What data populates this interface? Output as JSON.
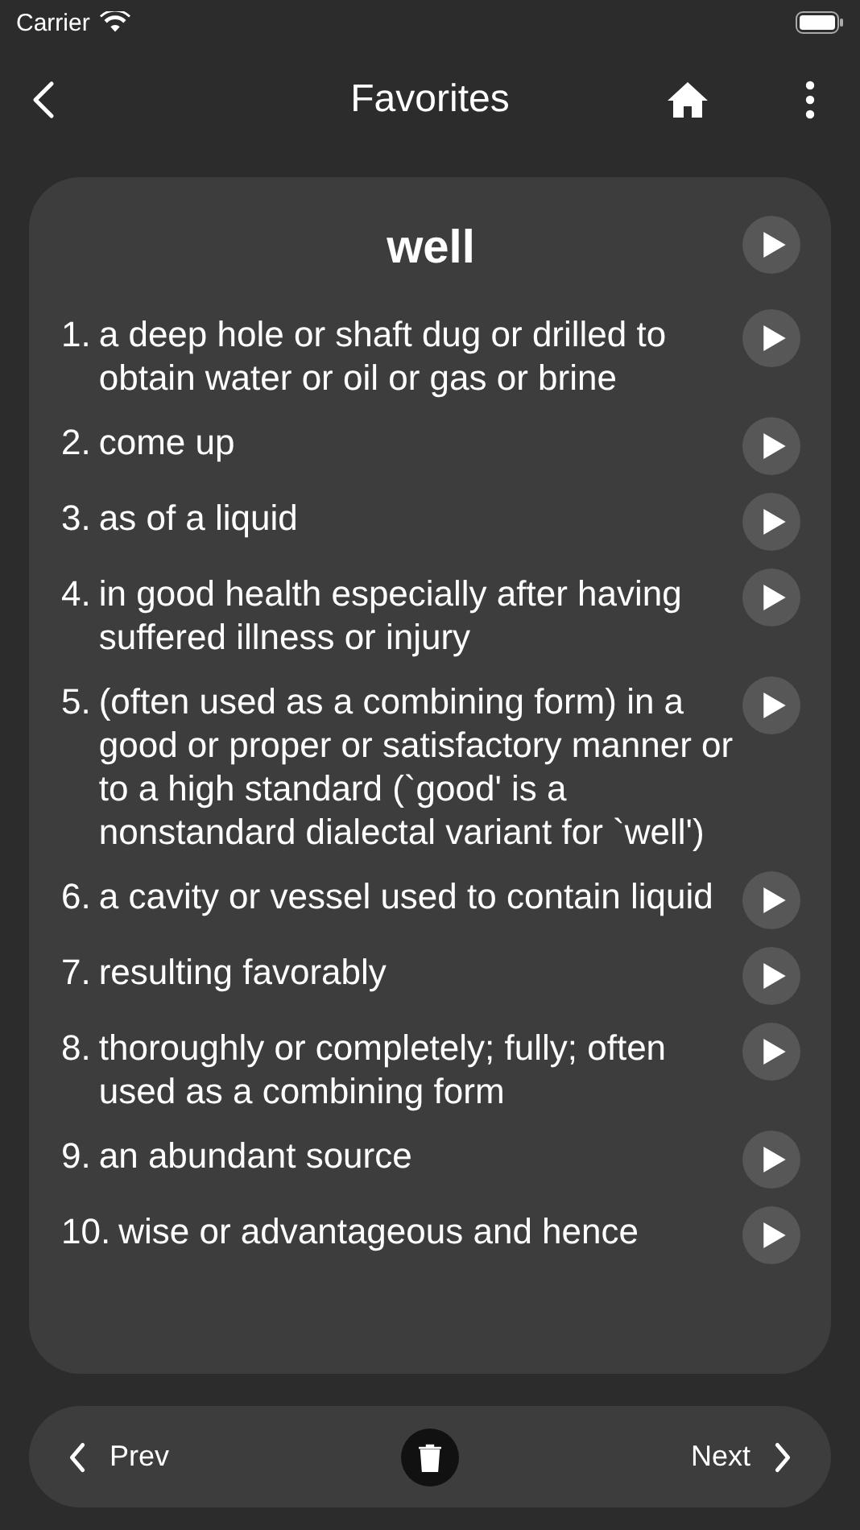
{
  "status_bar": {
    "carrier": "Carrier"
  },
  "nav": {
    "title": "Favorites"
  },
  "entry": {
    "word": "well",
    "definitions": [
      {
        "number": "1.",
        "text": "a deep hole or shaft dug or drilled to obtain water or oil or gas or brine"
      },
      {
        "number": "2.",
        "text": "come up"
      },
      {
        "number": "3.",
        "text": "as of a liquid"
      },
      {
        "number": "4.",
        "text": "in good health especially after having suffered illness or injury"
      },
      {
        "number": "5.",
        "text": "(often used as a combining form) in a good or proper or satisfactory manner or to a high standard (`good' is a nonstandard dialectal variant for `well')"
      },
      {
        "number": "6.",
        "text": "a cavity or vessel used to contain liquid"
      },
      {
        "number": "7.",
        "text": "resulting favorably"
      },
      {
        "number": "8.",
        "text": "thoroughly or completely; fully; often used as a combining form"
      },
      {
        "number": "9.",
        "text": "an abundant source"
      },
      {
        "number": "10.",
        "text": "wise or advantageous and hence"
      }
    ]
  },
  "footer": {
    "prev": "Prev",
    "next": "Next"
  }
}
